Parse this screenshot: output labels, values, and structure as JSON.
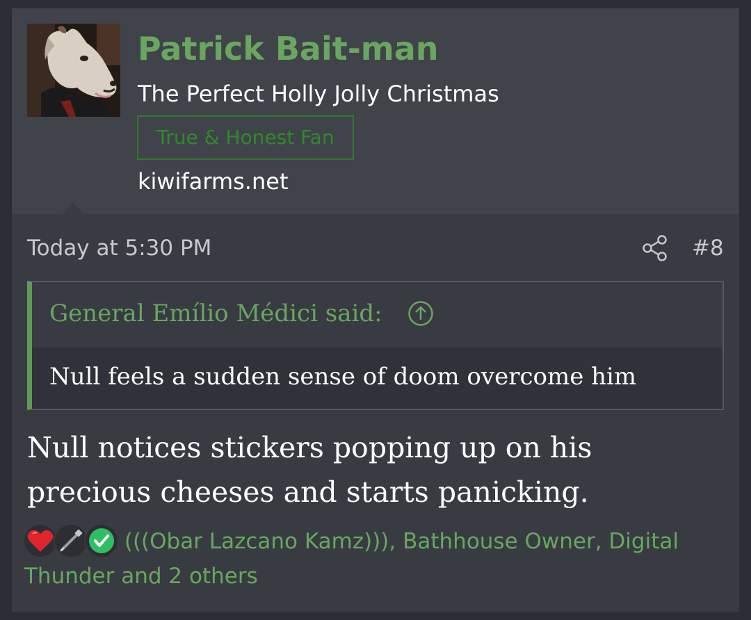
{
  "user": {
    "name": "Patrick Bait-man",
    "title": "The Perfect Holly Jolly Christmas",
    "banner": "True & Honest Fan",
    "site": "kiwifarms.net"
  },
  "post": {
    "timestamp": "Today at 5:30 PM",
    "number": "#8",
    "quote": {
      "author": "General Emílio Médici said:",
      "body": "Null feels a sudden sense of doom overcome him"
    },
    "message": "Null notices stickers popping up on his precious cheeses and starts panicking.",
    "reactions": {
      "icons": [
        "heart-icon",
        "syringe-icon",
        "checkmark-icon"
      ],
      "text": "(((Obar Lazcano Kamz))), Bathhouse Owner, Digital Thunder and 2 others"
    }
  },
  "colors": {
    "accent_green": "#6aa660",
    "banner_green": "#2f7a2a",
    "panel": "#383b42",
    "user_panel": "#40434a",
    "background": "#2b2e34"
  }
}
